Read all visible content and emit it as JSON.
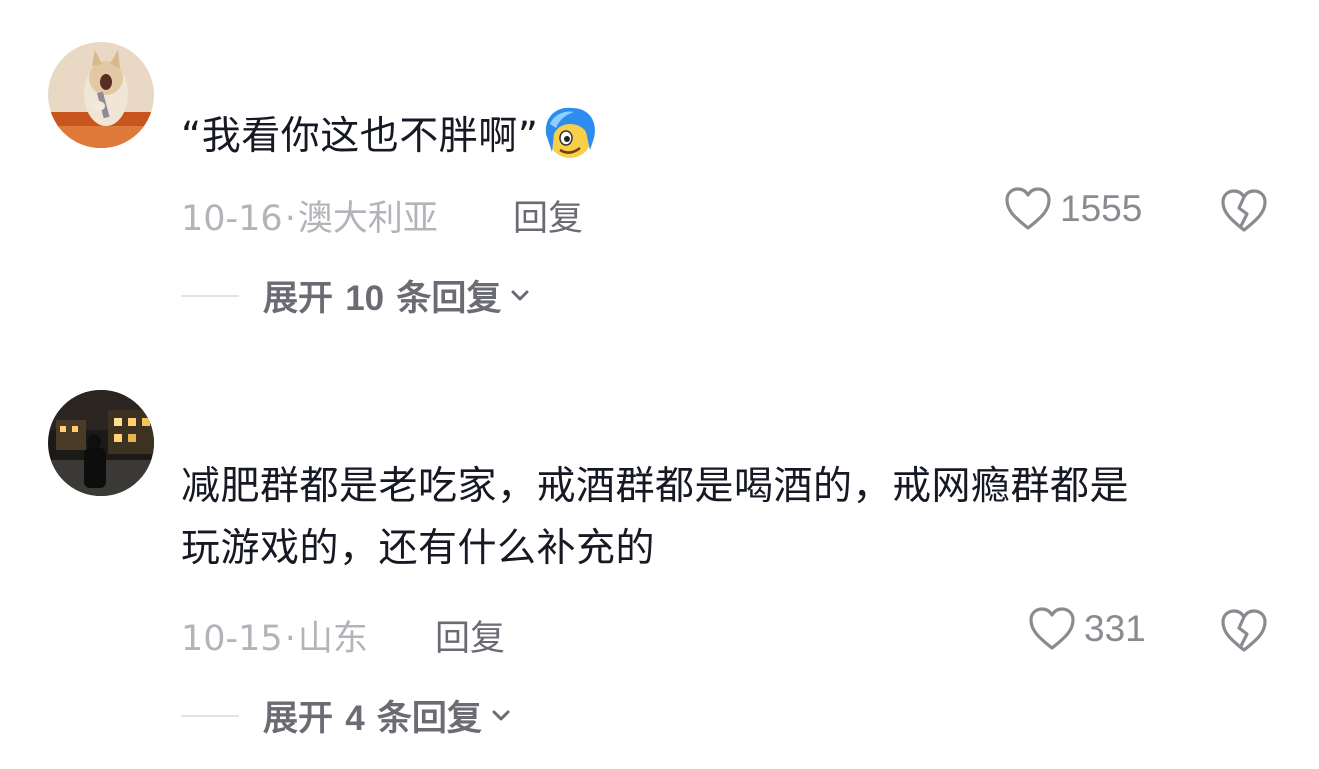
{
  "comments": [
    {
      "avatar": "cat-singing-avatar",
      "text": "“我看你这也不胖啊”",
      "emoji": "blue-hair-face-emoji",
      "date": "10-16",
      "location": "澳大利亚",
      "reply_label": "回复",
      "likes": "1555",
      "expand": {
        "prefix": "展开",
        "count": "10",
        "suffix": "条回复"
      }
    },
    {
      "avatar": "night-street-avatar",
      "text_line1": "减肥群都是老吃家，戒酒群都是喝酒的，戒网瘾群都是",
      "text_line2": "玩游戏的，还有什么补充的",
      "date": "10-15",
      "location": "山东",
      "reply_label": "回复",
      "likes": "331",
      "expand": {
        "prefix": "展开",
        "count": "4",
        "suffix": "条回复"
      }
    }
  ],
  "meta_separator": "·",
  "colors": {
    "text": "#161823",
    "meta": "#b3b4b9",
    "action": "#6a6b73",
    "icon": "#8a8b91"
  }
}
